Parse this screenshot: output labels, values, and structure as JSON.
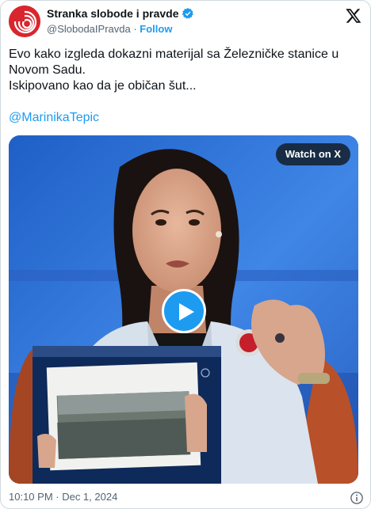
{
  "account": {
    "display_name": "Stranka slobode i pravde",
    "handle": "@SlobodaIPravda",
    "separator": " · ",
    "follow_label": "Follow",
    "verified": true,
    "brand_color": "#d8262f"
  },
  "tweet": {
    "lines": [
      "Evo kako izgleda dokazni materijal sa Železničke stanice u",
      "Novom Sadu.",
      "Iskipovano kao da je običan šut..."
    ],
    "mention": "@MarinikaTepic"
  },
  "media": {
    "watch_label": "Watch on X",
    "play_icon": "play-icon"
  },
  "footer": {
    "timestamp": "10:10 PM · Dec 1, 2024"
  },
  "colors": {
    "link": "#1d9bf0",
    "text": "#0f1419",
    "muted": "#536471"
  }
}
